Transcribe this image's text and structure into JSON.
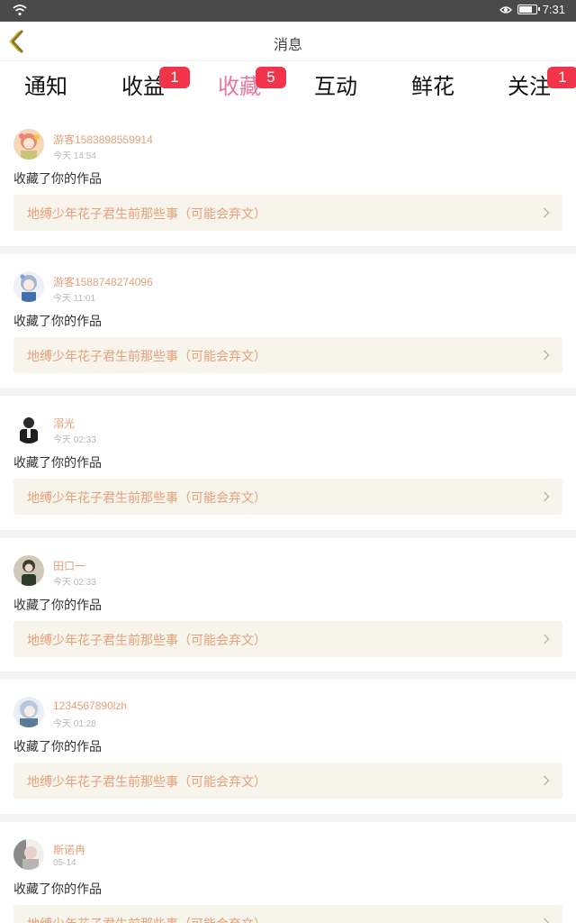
{
  "statusbar": {
    "time": "7:31"
  },
  "navbar": {
    "title": "消息"
  },
  "tabs": [
    {
      "label": "通知",
      "badge": ""
    },
    {
      "label": "收益",
      "badge": "1"
    },
    {
      "label": "收藏",
      "badge": "5",
      "active": true
    },
    {
      "label": "互动",
      "badge": ""
    },
    {
      "label": "鲜花",
      "badge": ""
    },
    {
      "label": "关注",
      "badge": "1"
    }
  ],
  "colors": {
    "accent": "#e8779e",
    "badge": "#f2344a",
    "username": "#e5a079",
    "work_bg": "#f7f4ec"
  },
  "items": [
    {
      "name": "游客1583898559914",
      "time": "今天 14:54",
      "action": "收藏了你的作品",
      "work": "地缚少年花子君生前那些事（可能会弃文）"
    },
    {
      "name": "游客1588748274096",
      "time": "今天 11:01",
      "action": "收藏了你的作品",
      "work": "地缚少年花子君生前那些事（可能会弃文）"
    },
    {
      "name": "溺光",
      "time": "今天 02:33",
      "action": "收藏了你的作品",
      "work": "地缚少年花子君生前那些事（可能会弃文）"
    },
    {
      "name": "田口一",
      "time": "今天 02:33",
      "action": "收藏了你的作品",
      "work": "地缚少年花子君生前那些事（可能会弃文）"
    },
    {
      "name": "1234567890lzh",
      "time": "今天 01:28",
      "action": "收藏了你的作品",
      "work": "地缚少年花子君生前那些事（可能会弃文）"
    },
    {
      "name": "斯诺冉",
      "time": "05-14",
      "action": "收藏了你的作品",
      "work": "地缚少年花子君生前那些事（可能会弃文）"
    }
  ]
}
